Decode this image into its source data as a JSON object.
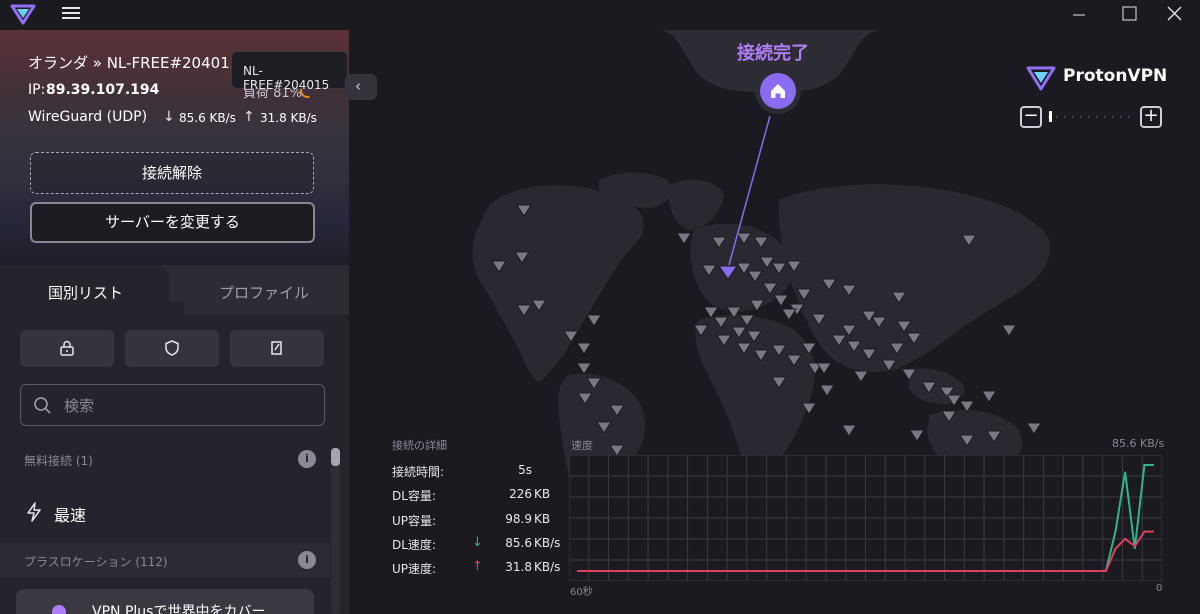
{
  "app": {
    "name": "Proton VPN",
    "brand_text": "ProtonVPN"
  },
  "titlebar": {
    "minimize_label": "—",
    "maximize_label": "☐",
    "close_label": "✕"
  },
  "connection": {
    "title": "オランダ » NL-FREE#204015",
    "server_tooltip": "NL-FREE#204015",
    "ip_label": "IP:",
    "ip": "89.39.107.194",
    "load_text": "負荷 81%",
    "load_value": 81,
    "protocol": "WireGuard (UDP)",
    "download_rate": "85.6 KB/s",
    "upload_rate": "31.8 KB/s",
    "disconnect_label": "接続解除",
    "change_server_label": "サーバーを変更する"
  },
  "tabs": [
    {
      "label": "国別リスト",
      "active": true
    },
    {
      "label": "プロファイル",
      "active": false
    }
  ],
  "filters": [
    {
      "icon": "lock-icon"
    },
    {
      "icon": "shield-icon"
    },
    {
      "icon": "edit-doc-icon"
    }
  ],
  "search": {
    "placeholder": "検索"
  },
  "sections": {
    "free": {
      "label": "無料接続 (1)"
    },
    "plus": {
      "label": "プラスロケーション (112)"
    }
  },
  "fastest_label": "最速",
  "promo_text": "VPN Plusで世界中をカバー",
  "map": {
    "status": "接続完了",
    "zoom": {
      "minus": "−",
      "plus": "+"
    }
  },
  "stats": {
    "title": "接続の詳細",
    "rows": [
      {
        "label": "接続時間:",
        "value": "5s",
        "unit": ""
      },
      {
        "label": "DL容量:",
        "value": "226",
        "unit": "KB"
      },
      {
        "label": "UP容量:",
        "value": "98.9",
        "unit": "KB"
      },
      {
        "label": "DL速度:",
        "value": "85.6",
        "unit": "KB/s",
        "arrow": "↓"
      },
      {
        "label": "UP速度:",
        "value": "31.8",
        "unit": "KB/s",
        "arrow": "↑"
      }
    ]
  },
  "speed_chart": {
    "title": "速度",
    "max_label": "85.6 KB/s",
    "x_start_label": "60秒",
    "x_end_label": "0"
  },
  "chart_data": {
    "type": "line",
    "title": "速度",
    "x": [
      0,
      1,
      2,
      3,
      4,
      5,
      6,
      7,
      8,
      9,
      10,
      11,
      12,
      13,
      14,
      15,
      16,
      17,
      18,
      19,
      20,
      21,
      22,
      23,
      24,
      25,
      26,
      27,
      28,
      29,
      30,
      31,
      32,
      33,
      34,
      35,
      36,
      37,
      38,
      39,
      40,
      41,
      42,
      43,
      44,
      45,
      46,
      47,
      48,
      49,
      50,
      51,
      52,
      53,
      54,
      55,
      56,
      57,
      58,
      59,
      60
    ],
    "ylim": [
      0,
      85.6
    ],
    "series": [
      {
        "color": "#2fb58a",
        "values": [
          0,
          0,
          0,
          0,
          0,
          0,
          0,
          0,
          0,
          0,
          0,
          0,
          0,
          0,
          0,
          0,
          0,
          0,
          0,
          0,
          0,
          0,
          0,
          0,
          0,
          0,
          0,
          0,
          0,
          0,
          0,
          0,
          0,
          0,
          0,
          0,
          0,
          0,
          0,
          0,
          0,
          0,
          0,
          0,
          0,
          0,
          0,
          0,
          0,
          0,
          0,
          0,
          0,
          0,
          0,
          0,
          32,
          80,
          18,
          85.6,
          85.6
        ]
      },
      {
        "color": "#e0405a",
        "values": [
          0,
          0,
          0,
          0,
          0,
          0,
          0,
          0,
          0,
          0,
          0,
          0,
          0,
          0,
          0,
          0,
          0,
          0,
          0,
          0,
          0,
          0,
          0,
          0,
          0,
          0,
          0,
          0,
          0,
          0,
          0,
          0,
          0,
          0,
          0,
          0,
          0,
          0,
          0,
          0,
          0,
          0,
          0,
          0,
          0,
          0,
          0,
          0,
          0,
          0,
          0,
          0,
          0,
          0,
          0,
          0,
          18,
          26,
          20,
          31.8,
          31.8
        ]
      }
    ]
  }
}
